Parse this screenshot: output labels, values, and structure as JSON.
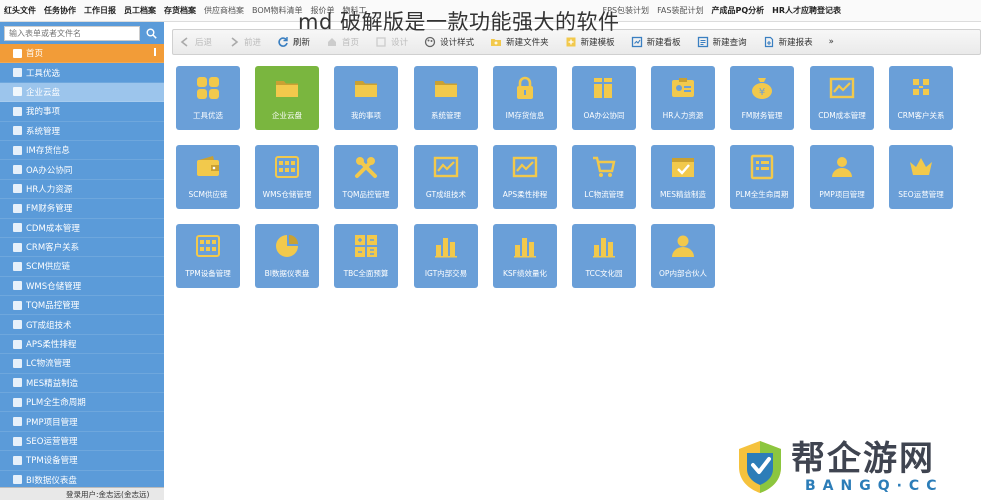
{
  "overlay_title": "md 破解版是一款功能强大的软件",
  "topbar": [
    {
      "label": "红头文件",
      "strong": true
    },
    {
      "label": "任务协作",
      "strong": true
    },
    {
      "label": "工作日报",
      "strong": true
    },
    {
      "label": "员工档案",
      "strong": true
    },
    {
      "label": "存货档案",
      "strong": true
    },
    {
      "label": "供应商档案",
      "strong": false
    },
    {
      "label": "BOM物料清单",
      "strong": false
    },
    {
      "label": "报价单",
      "strong": false
    },
    {
      "label": "物料工",
      "strong": false
    },
    {
      "label": "",
      "strong": false
    },
    {
      "label": "",
      "strong": false
    },
    {
      "label": "",
      "strong": false
    },
    {
      "label": "",
      "strong": false
    },
    {
      "label": "",
      "strong": false
    },
    {
      "label": "",
      "strong": false
    },
    {
      "label": "FPS包装计划",
      "strong": false
    },
    {
      "label": "FAS装配计划",
      "strong": false
    },
    {
      "label": "产成品PQ分析",
      "strong": true
    },
    {
      "label": "HR人才应聘登记表",
      "strong": true
    }
  ],
  "sidebar": {
    "search_placeholder": "输入表单或者文件名",
    "items": [
      {
        "label": "首页",
        "state": "active"
      },
      {
        "label": "工具优选",
        "state": ""
      },
      {
        "label": "企业云盘",
        "state": "selected"
      },
      {
        "label": "我的事项",
        "state": ""
      },
      {
        "label": "系统管理",
        "state": ""
      },
      {
        "label": "IM存货信息",
        "state": ""
      },
      {
        "label": "OA办公协同",
        "state": ""
      },
      {
        "label": "HR人力资源",
        "state": ""
      },
      {
        "label": "FM财务管理",
        "state": ""
      },
      {
        "label": "CDM成本管理",
        "state": ""
      },
      {
        "label": "CRM客户关系",
        "state": ""
      },
      {
        "label": "SCM供应链",
        "state": ""
      },
      {
        "label": "WMS仓储管理",
        "state": ""
      },
      {
        "label": "TQM品控管理",
        "state": ""
      },
      {
        "label": "GT成组技术",
        "state": ""
      },
      {
        "label": "APS柔性排程",
        "state": ""
      },
      {
        "label": "LC物流管理",
        "state": ""
      },
      {
        "label": "MES精益制造",
        "state": ""
      },
      {
        "label": "PLM全生命周期",
        "state": ""
      },
      {
        "label": "PMP项目管理",
        "state": ""
      },
      {
        "label": "SEO运营管理",
        "state": ""
      },
      {
        "label": "TPM设备管理",
        "state": ""
      },
      {
        "label": "BI数据仪表盘",
        "state": ""
      }
    ],
    "footer": "登录用户:金志远(金志远)"
  },
  "toolbar": [
    {
      "label": "后退",
      "icon": "arrow-left-icon",
      "faded": true
    },
    {
      "label": "前进",
      "icon": "arrow-right-icon",
      "faded": true
    },
    {
      "label": "刷新",
      "icon": "refresh-icon",
      "faded": false
    },
    {
      "label": "首页",
      "icon": "home-icon",
      "faded": true
    },
    {
      "label": "设计",
      "icon": "design-icon",
      "faded": true
    },
    {
      "label": "设计样式",
      "icon": "palette-icon",
      "faded": false
    },
    {
      "label": "新建文件夹",
      "icon": "folder-plus-icon",
      "faded": false
    },
    {
      "label": "新建模板",
      "icon": "template-plus-icon",
      "faded": false
    },
    {
      "label": "新建看板",
      "icon": "board-plus-icon",
      "faded": false
    },
    {
      "label": "新建查询",
      "icon": "query-plus-icon",
      "faded": false
    },
    {
      "label": "新建报表",
      "icon": "report-plus-icon",
      "faded": false
    },
    {
      "label": "»",
      "icon": "",
      "faded": false
    }
  ],
  "tiles": [
    {
      "label": "工具优选",
      "icon": "apps-icon",
      "active": false
    },
    {
      "label": "企业云盘",
      "icon": "folder-icon",
      "active": true
    },
    {
      "label": "我的事项",
      "icon": "folder-icon",
      "active": false
    },
    {
      "label": "系统管理",
      "icon": "folder-icon",
      "active": false
    },
    {
      "label": "IM存货信息",
      "icon": "lock-icon",
      "active": false
    },
    {
      "label": "OA办公协同",
      "icon": "books-icon",
      "active": false
    },
    {
      "label": "HR人力资源",
      "icon": "id-card-icon",
      "active": false
    },
    {
      "label": "FM财务管理",
      "icon": "money-bag-icon",
      "active": false
    },
    {
      "label": "CDM成本管理",
      "icon": "line-chart-icon",
      "active": false
    },
    {
      "label": "CRM客户关系",
      "icon": "network-icon",
      "active": false
    },
    {
      "label": "SCM供应链",
      "icon": "wallet-icon",
      "active": false
    },
    {
      "label": "WMS仓储管理",
      "icon": "grid-icon",
      "active": false
    },
    {
      "label": "TQM品控管理",
      "icon": "tools-icon",
      "active": false
    },
    {
      "label": "GT成组技术",
      "icon": "line-chart-icon",
      "active": false
    },
    {
      "label": "APS柔性排程",
      "icon": "line-chart-icon",
      "active": false
    },
    {
      "label": "LC物流管理",
      "icon": "cart-icon",
      "active": false
    },
    {
      "label": "MES精益制造",
      "icon": "checklist-icon",
      "active": false
    },
    {
      "label": "PLM全生命周期",
      "icon": "list-icon",
      "active": false
    },
    {
      "label": "PMP项目管理",
      "icon": "team-icon",
      "active": false
    },
    {
      "label": "SEO运营管理",
      "icon": "crown-icon",
      "active": false
    },
    {
      "label": "TPM设备管理",
      "icon": "grid-icon",
      "active": false
    },
    {
      "label": "BI数据仪表盘",
      "icon": "pie-chart-icon",
      "active": false
    },
    {
      "label": "TBC全面预算",
      "icon": "calculator-icon",
      "active": false
    },
    {
      "label": "IGT内部交易",
      "icon": "bar-chart-icon",
      "active": false
    },
    {
      "label": "KSF绩效量化",
      "icon": "bar-chart-icon",
      "active": false
    },
    {
      "label": "TCC文化园",
      "icon": "bar-chart-icon",
      "active": false
    },
    {
      "label": "OP内部合伙人",
      "icon": "user-icon",
      "active": false
    }
  ],
  "watermark": {
    "main": "帮企游网",
    "sub": "BANGQ·CC"
  },
  "colors": {
    "sidebar": "#5b9bd9",
    "active_menu": "#f29c38",
    "selected_menu": "#9cc5ec",
    "tile": "#6a9fd8",
    "tile_active": "#7ab63f",
    "tile_icon": "#f2c94c"
  }
}
